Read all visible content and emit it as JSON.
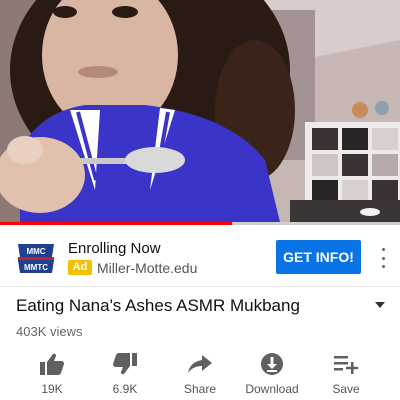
{
  "video": {
    "progress": 0.58
  },
  "ad": {
    "logo_lines": [
      "MMC",
      "MMTC"
    ],
    "title": "Enrolling Now",
    "badge": "Ad",
    "url": "Miller-Motte.edu",
    "cta": "GET INFO!",
    "more_icon": "more-vert-icon"
  },
  "video_info": {
    "title": "Eating Nana's Ashes ASMR Mukbang",
    "views": "403K views",
    "expand_icon": "chevron-down-icon"
  },
  "actions": [
    {
      "icon": "thumbs-up-icon",
      "label": "19K"
    },
    {
      "icon": "thumbs-down-icon",
      "label": "6.9K"
    },
    {
      "icon": "share-icon",
      "label": "Share"
    },
    {
      "icon": "download-icon",
      "label": "Download"
    },
    {
      "icon": "playlist-add-icon",
      "label": "Save"
    }
  ],
  "colors": {
    "progress": "#ff0000",
    "cta": "#0a74e6",
    "ad_badge": "#f2c200"
  }
}
